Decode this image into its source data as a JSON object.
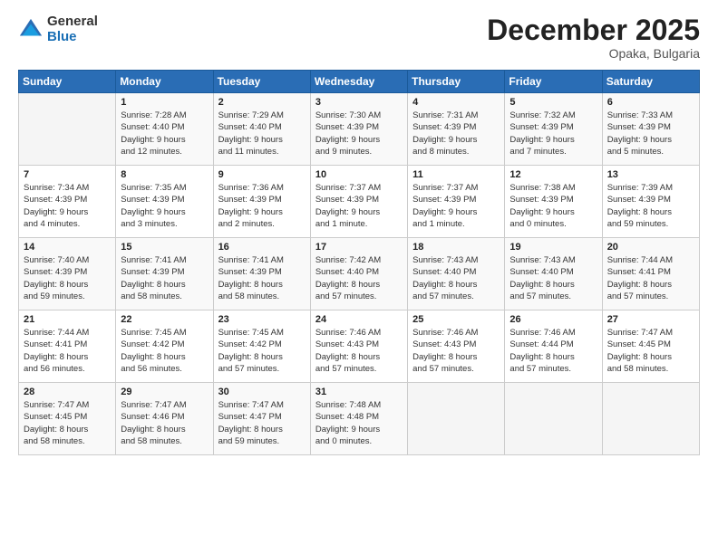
{
  "logo": {
    "general": "General",
    "blue": "Blue"
  },
  "header": {
    "month": "December 2025",
    "location": "Opaka, Bulgaria"
  },
  "weekdays": [
    "Sunday",
    "Monday",
    "Tuesday",
    "Wednesday",
    "Thursday",
    "Friday",
    "Saturday"
  ],
  "weeks": [
    [
      {
        "day": "",
        "info": ""
      },
      {
        "day": "1",
        "info": "Sunrise: 7:28 AM\nSunset: 4:40 PM\nDaylight: 9 hours\nand 12 minutes."
      },
      {
        "day": "2",
        "info": "Sunrise: 7:29 AM\nSunset: 4:40 PM\nDaylight: 9 hours\nand 11 minutes."
      },
      {
        "day": "3",
        "info": "Sunrise: 7:30 AM\nSunset: 4:39 PM\nDaylight: 9 hours\nand 9 minutes."
      },
      {
        "day": "4",
        "info": "Sunrise: 7:31 AM\nSunset: 4:39 PM\nDaylight: 9 hours\nand 8 minutes."
      },
      {
        "day": "5",
        "info": "Sunrise: 7:32 AM\nSunset: 4:39 PM\nDaylight: 9 hours\nand 7 minutes."
      },
      {
        "day": "6",
        "info": "Sunrise: 7:33 AM\nSunset: 4:39 PM\nDaylight: 9 hours\nand 5 minutes."
      }
    ],
    [
      {
        "day": "7",
        "info": "Sunrise: 7:34 AM\nSunset: 4:39 PM\nDaylight: 9 hours\nand 4 minutes."
      },
      {
        "day": "8",
        "info": "Sunrise: 7:35 AM\nSunset: 4:39 PM\nDaylight: 9 hours\nand 3 minutes."
      },
      {
        "day": "9",
        "info": "Sunrise: 7:36 AM\nSunset: 4:39 PM\nDaylight: 9 hours\nand 2 minutes."
      },
      {
        "day": "10",
        "info": "Sunrise: 7:37 AM\nSunset: 4:39 PM\nDaylight: 9 hours\nand 1 minute."
      },
      {
        "day": "11",
        "info": "Sunrise: 7:37 AM\nSunset: 4:39 PM\nDaylight: 9 hours\nand 1 minute."
      },
      {
        "day": "12",
        "info": "Sunrise: 7:38 AM\nSunset: 4:39 PM\nDaylight: 9 hours\nand 0 minutes."
      },
      {
        "day": "13",
        "info": "Sunrise: 7:39 AM\nSunset: 4:39 PM\nDaylight: 8 hours\nand 59 minutes."
      }
    ],
    [
      {
        "day": "14",
        "info": "Sunrise: 7:40 AM\nSunset: 4:39 PM\nDaylight: 8 hours\nand 59 minutes."
      },
      {
        "day": "15",
        "info": "Sunrise: 7:41 AM\nSunset: 4:39 PM\nDaylight: 8 hours\nand 58 minutes."
      },
      {
        "day": "16",
        "info": "Sunrise: 7:41 AM\nSunset: 4:39 PM\nDaylight: 8 hours\nand 58 minutes."
      },
      {
        "day": "17",
        "info": "Sunrise: 7:42 AM\nSunset: 4:40 PM\nDaylight: 8 hours\nand 57 minutes."
      },
      {
        "day": "18",
        "info": "Sunrise: 7:43 AM\nSunset: 4:40 PM\nDaylight: 8 hours\nand 57 minutes."
      },
      {
        "day": "19",
        "info": "Sunrise: 7:43 AM\nSunset: 4:40 PM\nDaylight: 8 hours\nand 57 minutes."
      },
      {
        "day": "20",
        "info": "Sunrise: 7:44 AM\nSunset: 4:41 PM\nDaylight: 8 hours\nand 57 minutes."
      }
    ],
    [
      {
        "day": "21",
        "info": "Sunrise: 7:44 AM\nSunset: 4:41 PM\nDaylight: 8 hours\nand 56 minutes."
      },
      {
        "day": "22",
        "info": "Sunrise: 7:45 AM\nSunset: 4:42 PM\nDaylight: 8 hours\nand 56 minutes."
      },
      {
        "day": "23",
        "info": "Sunrise: 7:45 AM\nSunset: 4:42 PM\nDaylight: 8 hours\nand 57 minutes."
      },
      {
        "day": "24",
        "info": "Sunrise: 7:46 AM\nSunset: 4:43 PM\nDaylight: 8 hours\nand 57 minutes."
      },
      {
        "day": "25",
        "info": "Sunrise: 7:46 AM\nSunset: 4:43 PM\nDaylight: 8 hours\nand 57 minutes."
      },
      {
        "day": "26",
        "info": "Sunrise: 7:46 AM\nSunset: 4:44 PM\nDaylight: 8 hours\nand 57 minutes."
      },
      {
        "day": "27",
        "info": "Sunrise: 7:47 AM\nSunset: 4:45 PM\nDaylight: 8 hours\nand 58 minutes."
      }
    ],
    [
      {
        "day": "28",
        "info": "Sunrise: 7:47 AM\nSunset: 4:45 PM\nDaylight: 8 hours\nand 58 minutes."
      },
      {
        "day": "29",
        "info": "Sunrise: 7:47 AM\nSunset: 4:46 PM\nDaylight: 8 hours\nand 58 minutes."
      },
      {
        "day": "30",
        "info": "Sunrise: 7:47 AM\nSunset: 4:47 PM\nDaylight: 8 hours\nand 59 minutes."
      },
      {
        "day": "31",
        "info": "Sunrise: 7:48 AM\nSunset: 4:48 PM\nDaylight: 9 hours\nand 0 minutes."
      },
      {
        "day": "",
        "info": ""
      },
      {
        "day": "",
        "info": ""
      },
      {
        "day": "",
        "info": ""
      }
    ]
  ]
}
